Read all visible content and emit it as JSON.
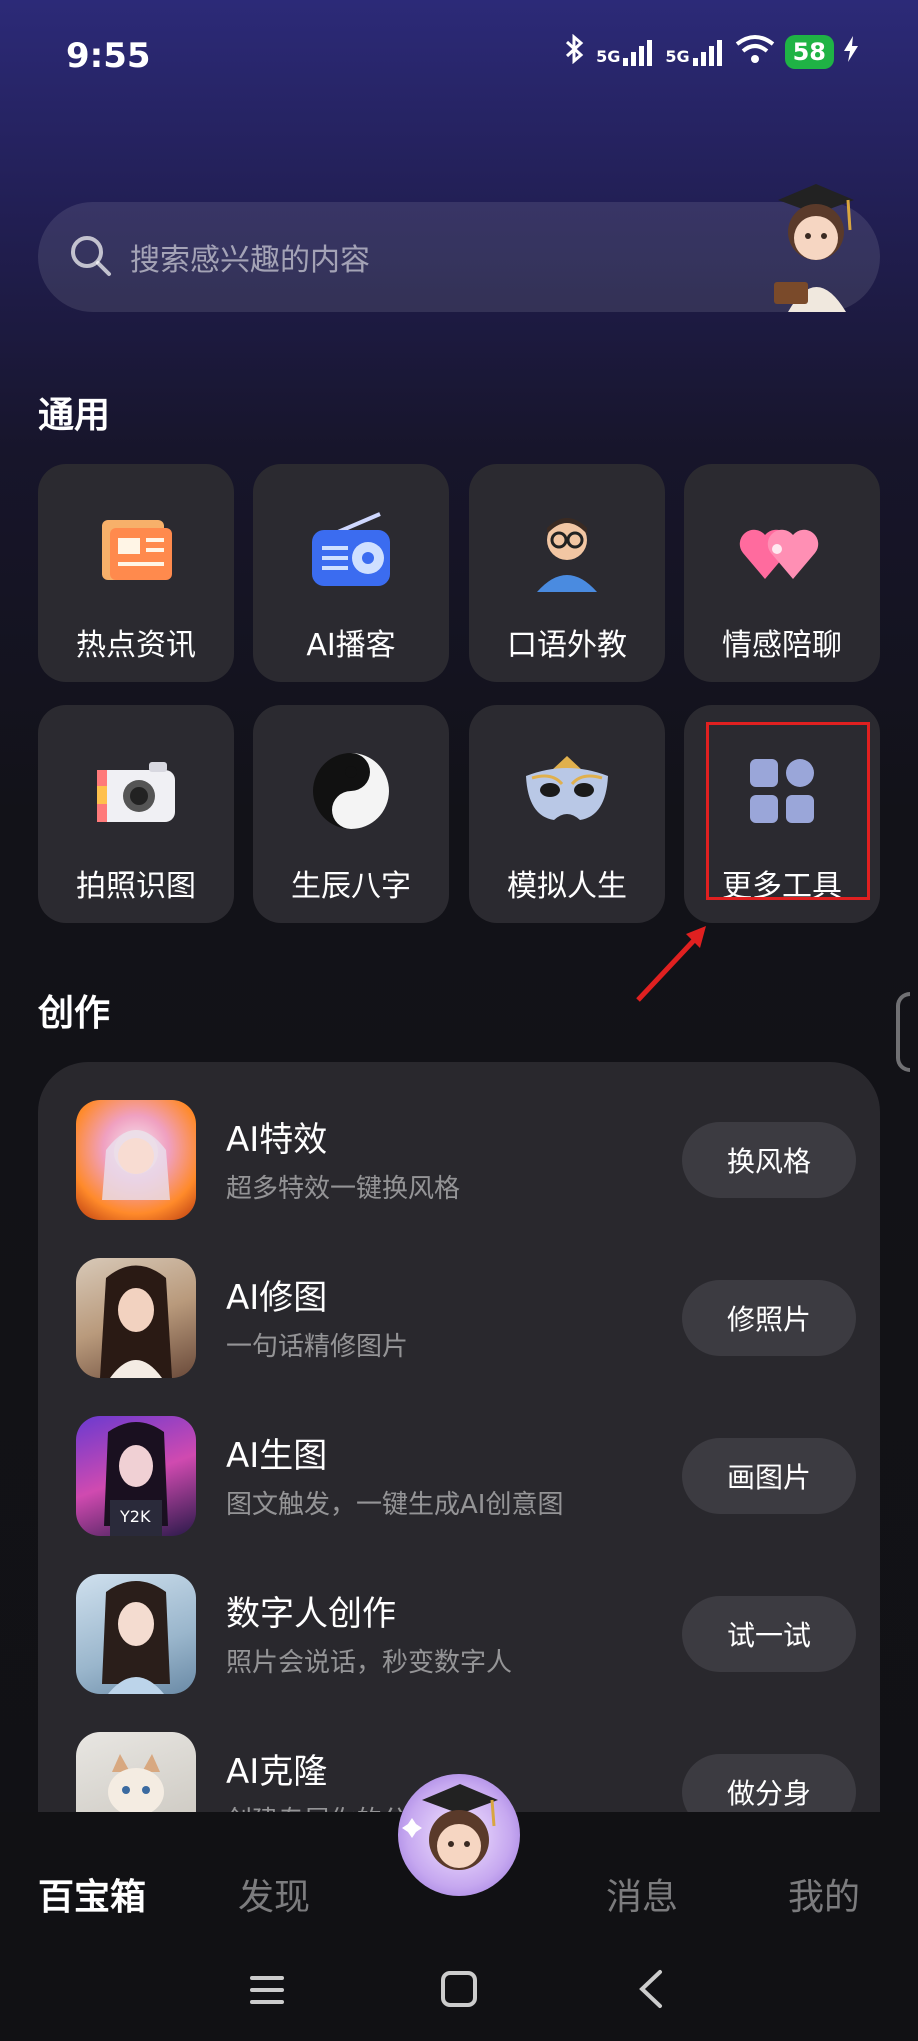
{
  "status_bar": {
    "time": "9:55",
    "battery": "58",
    "signal1": "5G",
    "signal2": "5G"
  },
  "search": {
    "placeholder": "搜索感兴趣的内容"
  },
  "sections": {
    "general": "通用",
    "create": "创作"
  },
  "tools": [
    {
      "label": "热点资讯",
      "icon": "newspaper-icon"
    },
    {
      "label": "AI播客",
      "icon": "radio-icon"
    },
    {
      "label": "口语外教",
      "icon": "teacher-avatar-icon"
    },
    {
      "label": "情感陪聊",
      "icon": "hearts-icon"
    },
    {
      "label": "拍照识图",
      "icon": "camera-icon"
    },
    {
      "label": "生辰八字",
      "icon": "yin-yang-icon"
    },
    {
      "label": "模拟人生",
      "icon": "mask-icon"
    },
    {
      "label": "更多工具",
      "icon": "grid-apps-icon"
    }
  ],
  "create_items": [
    {
      "title": "AI特效",
      "subtitle": "超多特效一键换风格",
      "button": "换风格"
    },
    {
      "title": "AI修图",
      "subtitle": "一句话精修图片",
      "button": "修照片"
    },
    {
      "title": "AI生图",
      "subtitle": "图文触发，一键生成AI创意图",
      "button": "画图片"
    },
    {
      "title": "数字人创作",
      "subtitle": "照片会说话，秒变数字人",
      "button": "试一试"
    },
    {
      "title": "AI克隆",
      "subtitle": "创建专属你的分身",
      "button": "做分身"
    }
  ],
  "bottom_nav": [
    "百宝箱",
    "发现",
    "消息",
    "我的"
  ],
  "colors": {
    "highlight_box": "#e02020",
    "arrow": "#e02020",
    "tile_bg": "#2b2a30"
  }
}
